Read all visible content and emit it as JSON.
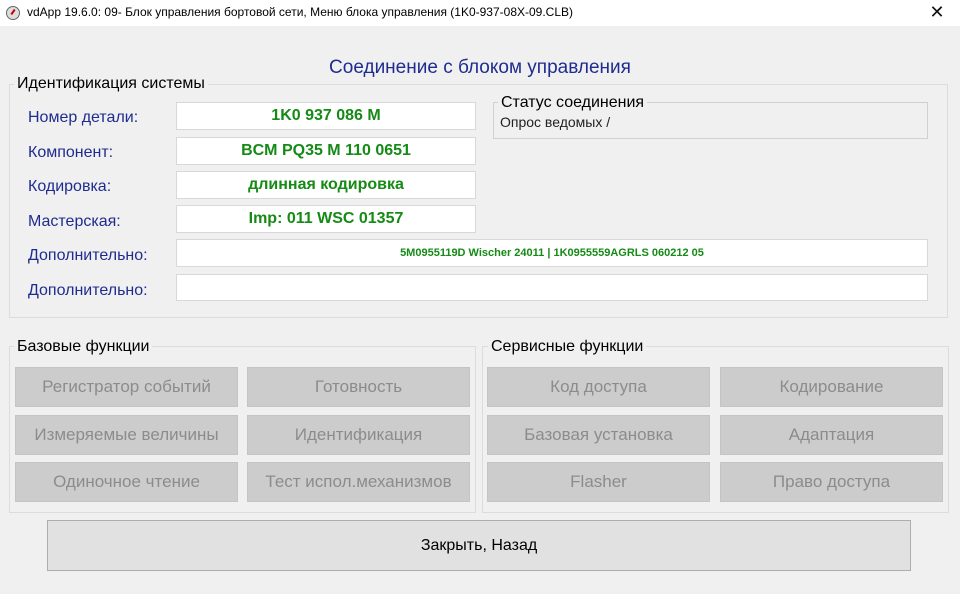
{
  "titlebar": {
    "title": "vdApp 19.6.0: 09- Блок управления бортовой сети,  Меню блока управления (1K0-937-08X-09.CLB)",
    "close_glyph": "✕",
    "app_icon": "gauge-icon"
  },
  "header": {
    "title": "Соединение с блоком управления"
  },
  "identification": {
    "group_label": "Идентификация системы",
    "fields": [
      {
        "label": "Номер детали:",
        "value": "1K0 937 086 M"
      },
      {
        "label": "Компонент:",
        "value": "BCM PQ35  M   110 0651"
      },
      {
        "label": "Кодировка:",
        "value": "длинная кодировка"
      },
      {
        "label": "Мастерская:",
        "value": "Imp: 011     WSC 01357"
      },
      {
        "label": "Дополнительно:",
        "value": "5M0955119D Wischer 24011  |  1K0955559AGRLS 060212 05"
      },
      {
        "label": "Дополнительно:",
        "value": ""
      }
    ]
  },
  "status": {
    "group_label": "Статус соединения",
    "text": "Опрос ведомых /"
  },
  "basic_functions": {
    "group_label": "Базовые функции",
    "buttons": [
      "Регистратор событий",
      "Готовность",
      "Измеряемые величины",
      "Идентификация",
      "Одиночное чтение",
      "Тест испол.механизмов"
    ]
  },
  "service_functions": {
    "group_label": "Сервисные функции",
    "buttons": [
      "Код доступа",
      "Кодирование",
      "Базовая установка",
      "Адаптация",
      "Flasher",
      "Право доступа"
    ]
  },
  "footer": {
    "close_label": "Закрыть, Назад"
  },
  "colors": {
    "label_blue": "#1f2c8f",
    "value_green": "#158a15",
    "disabled_button": "#cccccc",
    "disabled_text": "#8c8c8c"
  }
}
